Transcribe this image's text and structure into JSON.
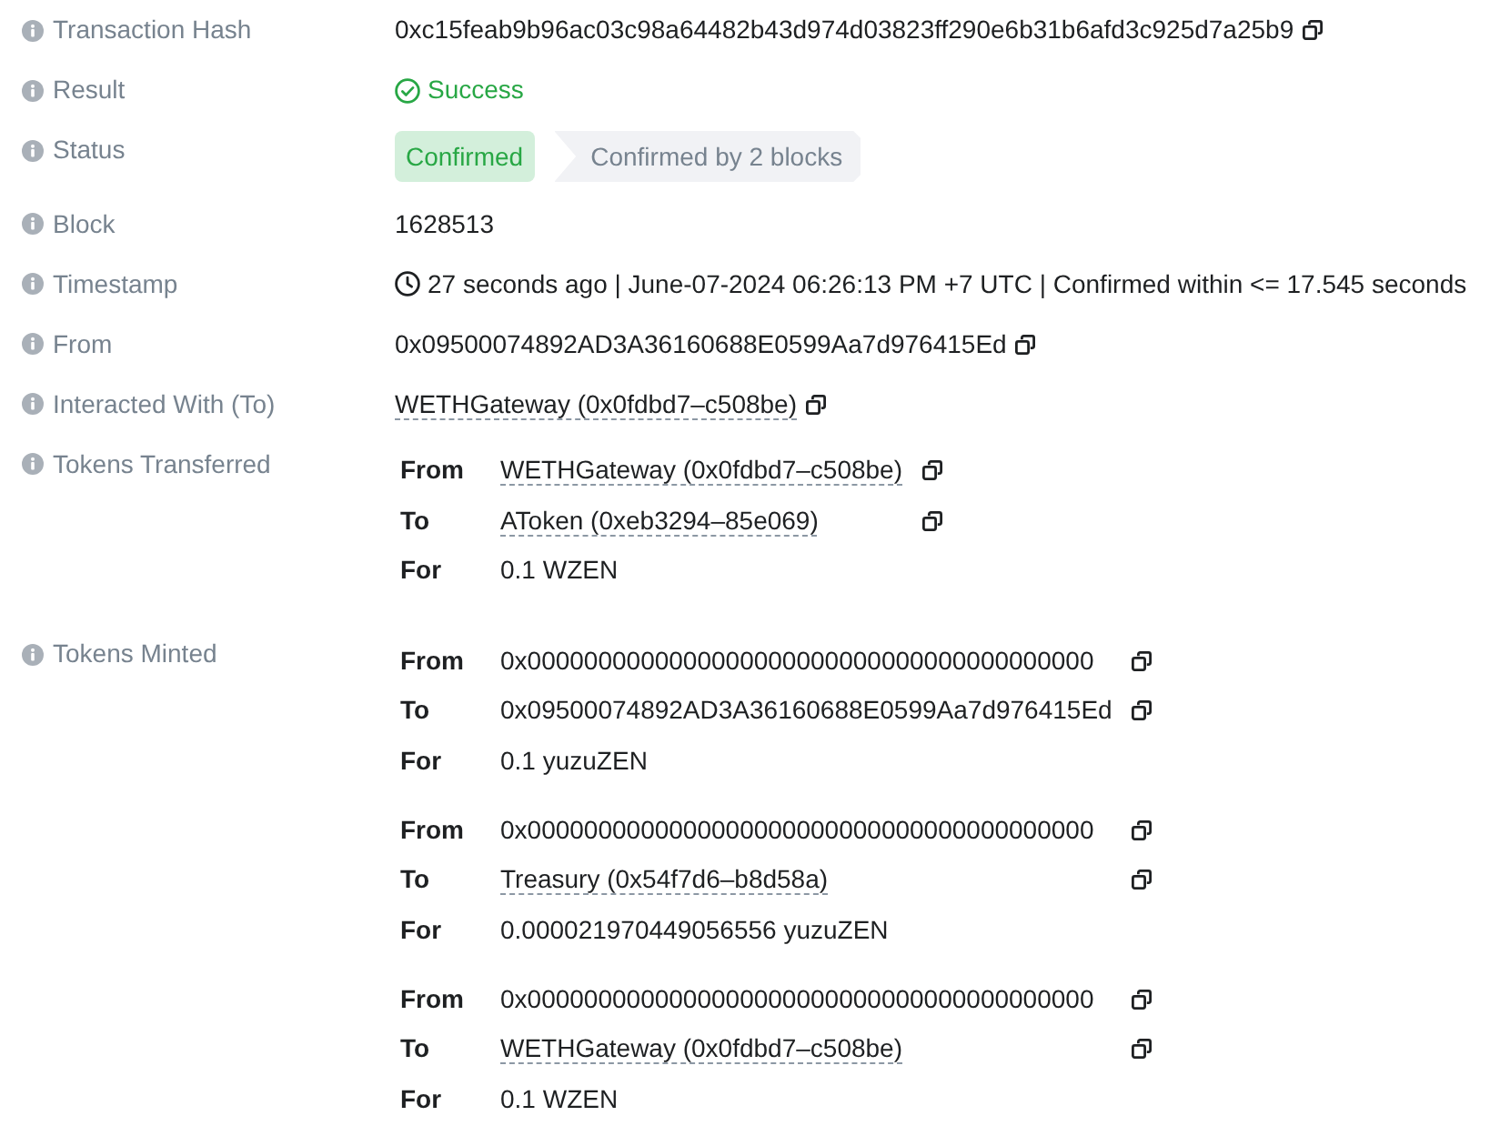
{
  "fields": [
    {
      "kind": "hash",
      "label": "Transaction Hash",
      "value": "0xc15feab9b96ac03c98a64482b43d974d03823ff290e6b31b6afd3c925d7a25b9",
      "copyable": true
    },
    {
      "kind": "result",
      "label": "Result",
      "value": "Success"
    },
    {
      "kind": "status",
      "label": "Status",
      "badges": [
        {
          "kind": "success",
          "text": "Confirmed"
        },
        {
          "kind": "step",
          "text": "Confirmed by 2 blocks"
        }
      ]
    },
    {
      "kind": "text",
      "label": "Block",
      "value": "1628513",
      "copyable": false
    },
    {
      "kind": "timestamp",
      "label": "Timestamp",
      "value": "27 seconds ago | June-07-2024 06:26:13 PM +7 UTC | Confirmed within <= 17.545 seconds"
    },
    {
      "kind": "hash",
      "label": "From",
      "value": "0x09500074892AD3A36160688E0599Aa7d976415Ed",
      "copyable": true
    },
    {
      "kind": "link",
      "label": "Interacted With (To)",
      "value": "WETHGateway (0x0fdbd7–c508be)",
      "copyable": true
    },
    {
      "kind": "tokens",
      "label": "Tokens Transferred",
      "groups": [
        {
          "rows": [
            {
              "label": "From",
              "value": "WETHGateway (0x0fdbd7–c508be)",
              "link": true,
              "copyable": true
            },
            {
              "label": "To",
              "value": "AToken (0xeb3294–85e069)",
              "link": true,
              "copyable": true
            },
            {
              "label": "For",
              "value": "0.1 WZEN",
              "link": false,
              "copyable": false
            }
          ]
        }
      ]
    },
    {
      "kind": "tokens",
      "label": "Tokens Minted",
      "groups": [
        {
          "rows": [
            {
              "label": "From",
              "value": "0x0000000000000000000000000000000000000000",
              "link": false,
              "copyable": true
            },
            {
              "label": "To",
              "value": "0x09500074892AD3A36160688E0599Aa7d976415Ed",
              "link": false,
              "copyable": true
            },
            {
              "label": "For",
              "value": "0.1 yuzuZEN",
              "link": false,
              "copyable": false
            }
          ]
        },
        {
          "rows": [
            {
              "label": "From",
              "value": "0x0000000000000000000000000000000000000000",
              "link": false,
              "copyable": true
            },
            {
              "label": "To",
              "value": "Treasury (0x54f7d6–b8d58a)",
              "link": true,
              "copyable": true
            },
            {
              "label": "For",
              "value": "0.000021970449056556 yuzuZEN",
              "link": false,
              "copyable": false
            }
          ]
        },
        {
          "rows": [
            {
              "label": "From",
              "value": "0x0000000000000000000000000000000000000000",
              "link": false,
              "copyable": true
            },
            {
              "label": "To",
              "value": "WETHGateway (0x0fdbd7–c508be)",
              "link": true,
              "copyable": true
            },
            {
              "label": "For",
              "value": "0.1 WZEN",
              "link": false,
              "copyable": false
            }
          ]
        }
      ]
    }
  ]
}
